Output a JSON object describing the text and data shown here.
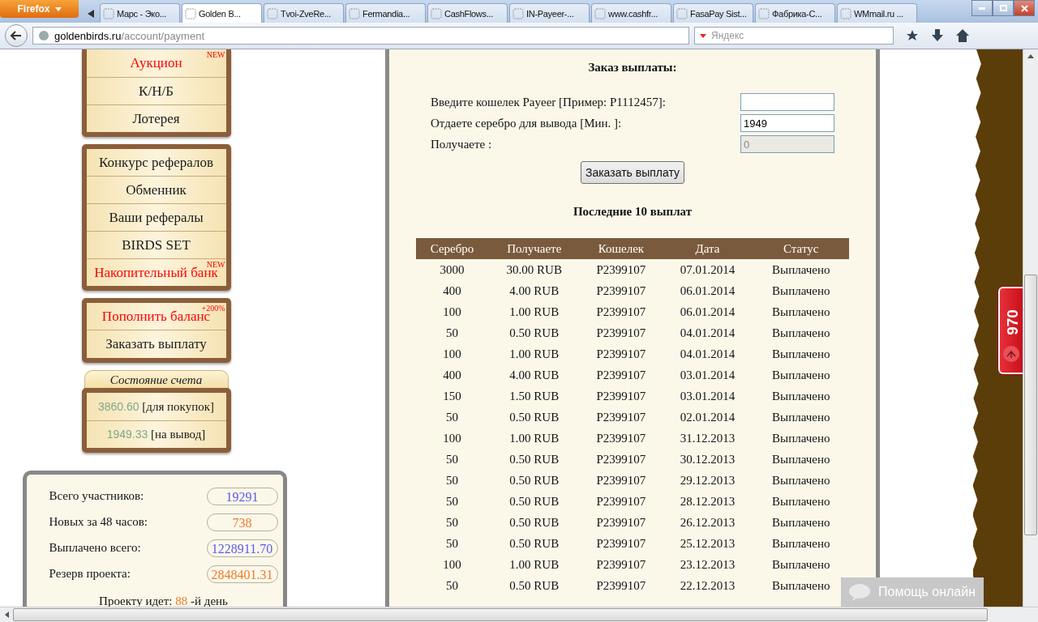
{
  "browser": {
    "menu_button": "Firefox",
    "tabs": [
      {
        "title": "Марс - Эко...",
        "selected": false
      },
      {
        "title": "Golden B...",
        "selected": true
      },
      {
        "title": "Tvoi-ZveRe...",
        "selected": false
      },
      {
        "title": "Fermandia...",
        "selected": false
      },
      {
        "title": "CashFlows...",
        "selected": false
      },
      {
        "title": "IN-Payeer-...",
        "selected": false
      },
      {
        "title": "www.cashfr...",
        "selected": false
      },
      {
        "title": "FasaPay Sist...",
        "selected": false
      },
      {
        "title": "Фабрика-С...",
        "selected": false
      },
      {
        "title": "WMmail.ru ...",
        "selected": false
      }
    ],
    "url_host": "goldenbirds.ru",
    "url_path": "/account/payment",
    "search_placeholder": "Яндекс"
  },
  "sidebar": {
    "menus": [
      {
        "items": [
          {
            "label": "Аукцион",
            "accent": true,
            "badge": "NEW"
          },
          {
            "label": "К/Н/Б",
            "accent": false
          },
          {
            "label": "Лотерея",
            "accent": false
          }
        ]
      },
      {
        "items": [
          {
            "label": "Конкурс рефералов",
            "accent": false
          },
          {
            "label": "Обменник",
            "accent": false
          },
          {
            "label": "Ваши рефералы",
            "accent": false
          },
          {
            "label": "BIRDS SET",
            "accent": false
          },
          {
            "label": "Накопительный банк",
            "accent": true,
            "badge": "NEW"
          }
        ]
      },
      {
        "items": [
          {
            "label": "Пополнить баланс",
            "accent": true,
            "badge": "+200%"
          },
          {
            "label": "Заказать выплату",
            "accent": false
          }
        ]
      }
    ],
    "account": {
      "title": "Состояние счета",
      "lines": [
        {
          "amount": "3860.60",
          "label": "[для покупок]"
        },
        {
          "amount": "1949.33",
          "label": "[на вывод]"
        }
      ]
    },
    "stats": [
      {
        "label": "Всего участников:",
        "value": "19291",
        "color": "#5a5af0"
      },
      {
        "label": "Новых за 48 часов:",
        "value": "738",
        "color": "#f07a2a"
      },
      {
        "label": "Выплачено всего:",
        "value": "1228911.70",
        "color": "#5a5af0"
      },
      {
        "label": "Резерв проекта:",
        "value": "2848401.31",
        "color": "#f07a2a"
      }
    ],
    "project_age": {
      "prefix": "Проекту идет:",
      "days": "88",
      "suffix": "-й день"
    }
  },
  "payout": {
    "title": "Заказ выплаты:",
    "fields": [
      {
        "label": "Введите кошелек Payeer [Пример: P1112457]:",
        "disabled": false
      },
      {
        "label": "Отдаете серебро для вывода [Мин. ]:",
        "value": "1949",
        "disabled": false
      },
      {
        "label": "Получаете :",
        "value": "0",
        "disabled": true
      }
    ],
    "button": "Заказать выплату",
    "history_title": "Последние 10 выплат",
    "table": {
      "columns": [
        "Серебро",
        "Получаете",
        "Кошелек",
        "Дата",
        "Статус"
      ],
      "rows": [
        [
          "3000",
          "30.00 RUB",
          "P2399107",
          "07.01.2014",
          "Выплачено"
        ],
        [
          "400",
          "4.00 RUB",
          "P2399107",
          "06.01.2014",
          "Выплачено"
        ],
        [
          "100",
          "1.00 RUB",
          "P2399107",
          "06.01.2014",
          "Выплачено"
        ],
        [
          "50",
          "0.50 RUB",
          "P2399107",
          "04.01.2014",
          "Выплачено"
        ],
        [
          "100",
          "1.00 RUB",
          "P2399107",
          "04.01.2014",
          "Выплачено"
        ],
        [
          "400",
          "4.00 RUB",
          "P2399107",
          "03.01.2014",
          "Выплачено"
        ],
        [
          "150",
          "1.50 RUB",
          "P2399107",
          "03.01.2014",
          "Выплачено"
        ],
        [
          "50",
          "0.50 RUB",
          "P2399107",
          "02.01.2014",
          "Выплачено"
        ],
        [
          "100",
          "1.00 RUB",
          "P2399107",
          "31.12.2013",
          "Выплачено"
        ],
        [
          "50",
          "0.50 RUB",
          "P2399107",
          "30.12.2013",
          "Выплачено"
        ],
        [
          "50",
          "0.50 RUB",
          "P2399107",
          "29.12.2013",
          "Выплачено"
        ],
        [
          "50",
          "0.50 RUB",
          "P2399107",
          "28.12.2013",
          "Выплачено"
        ],
        [
          "50",
          "0.50 RUB",
          "P2399107",
          "26.12.2013",
          "Выплачено"
        ],
        [
          "50",
          "0.50 RUB",
          "P2399107",
          "25.12.2013",
          "Выплачено"
        ],
        [
          "100",
          "1.00 RUB",
          "P2399107",
          "23.12.2013",
          "Выплачено"
        ],
        [
          "50",
          "0.50 RUB",
          "P2399107",
          "22.12.2013",
          "Выплачено"
        ]
      ]
    }
  },
  "counter_badge": "970",
  "help_button": "Помощь онлайн"
}
